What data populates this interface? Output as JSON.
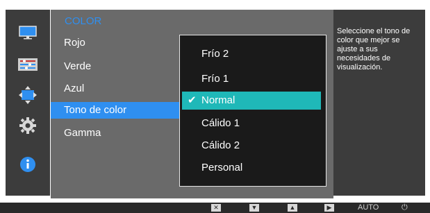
{
  "osd": {
    "header": "COLOR",
    "menu": [
      "Rojo",
      "Verde",
      "Azul",
      "Tono de color",
      "Gamma"
    ],
    "selected_menu_index": 3,
    "submenu": [
      "Frío 2",
      "Frío 1",
      "Normal",
      "Cálido 1",
      "Cálido 2",
      "Personal"
    ],
    "selected_submenu_index": 2,
    "help": "Seleccione el tono de color que mejor se ajuste a sus necesidades de visualización."
  },
  "sidebar_icons": [
    "monitor-icon",
    "color-bars-icon",
    "move-arrows-icon",
    "gear-icon",
    "info-icon"
  ],
  "bottom_keys": {
    "close": "✕",
    "down": "▼",
    "up": "▲",
    "right": "▶",
    "auto": "AUTO",
    "power": "⏻"
  },
  "colors": {
    "accent_blue": "#2f8ff0",
    "selection_teal": "#1fb8b8"
  }
}
